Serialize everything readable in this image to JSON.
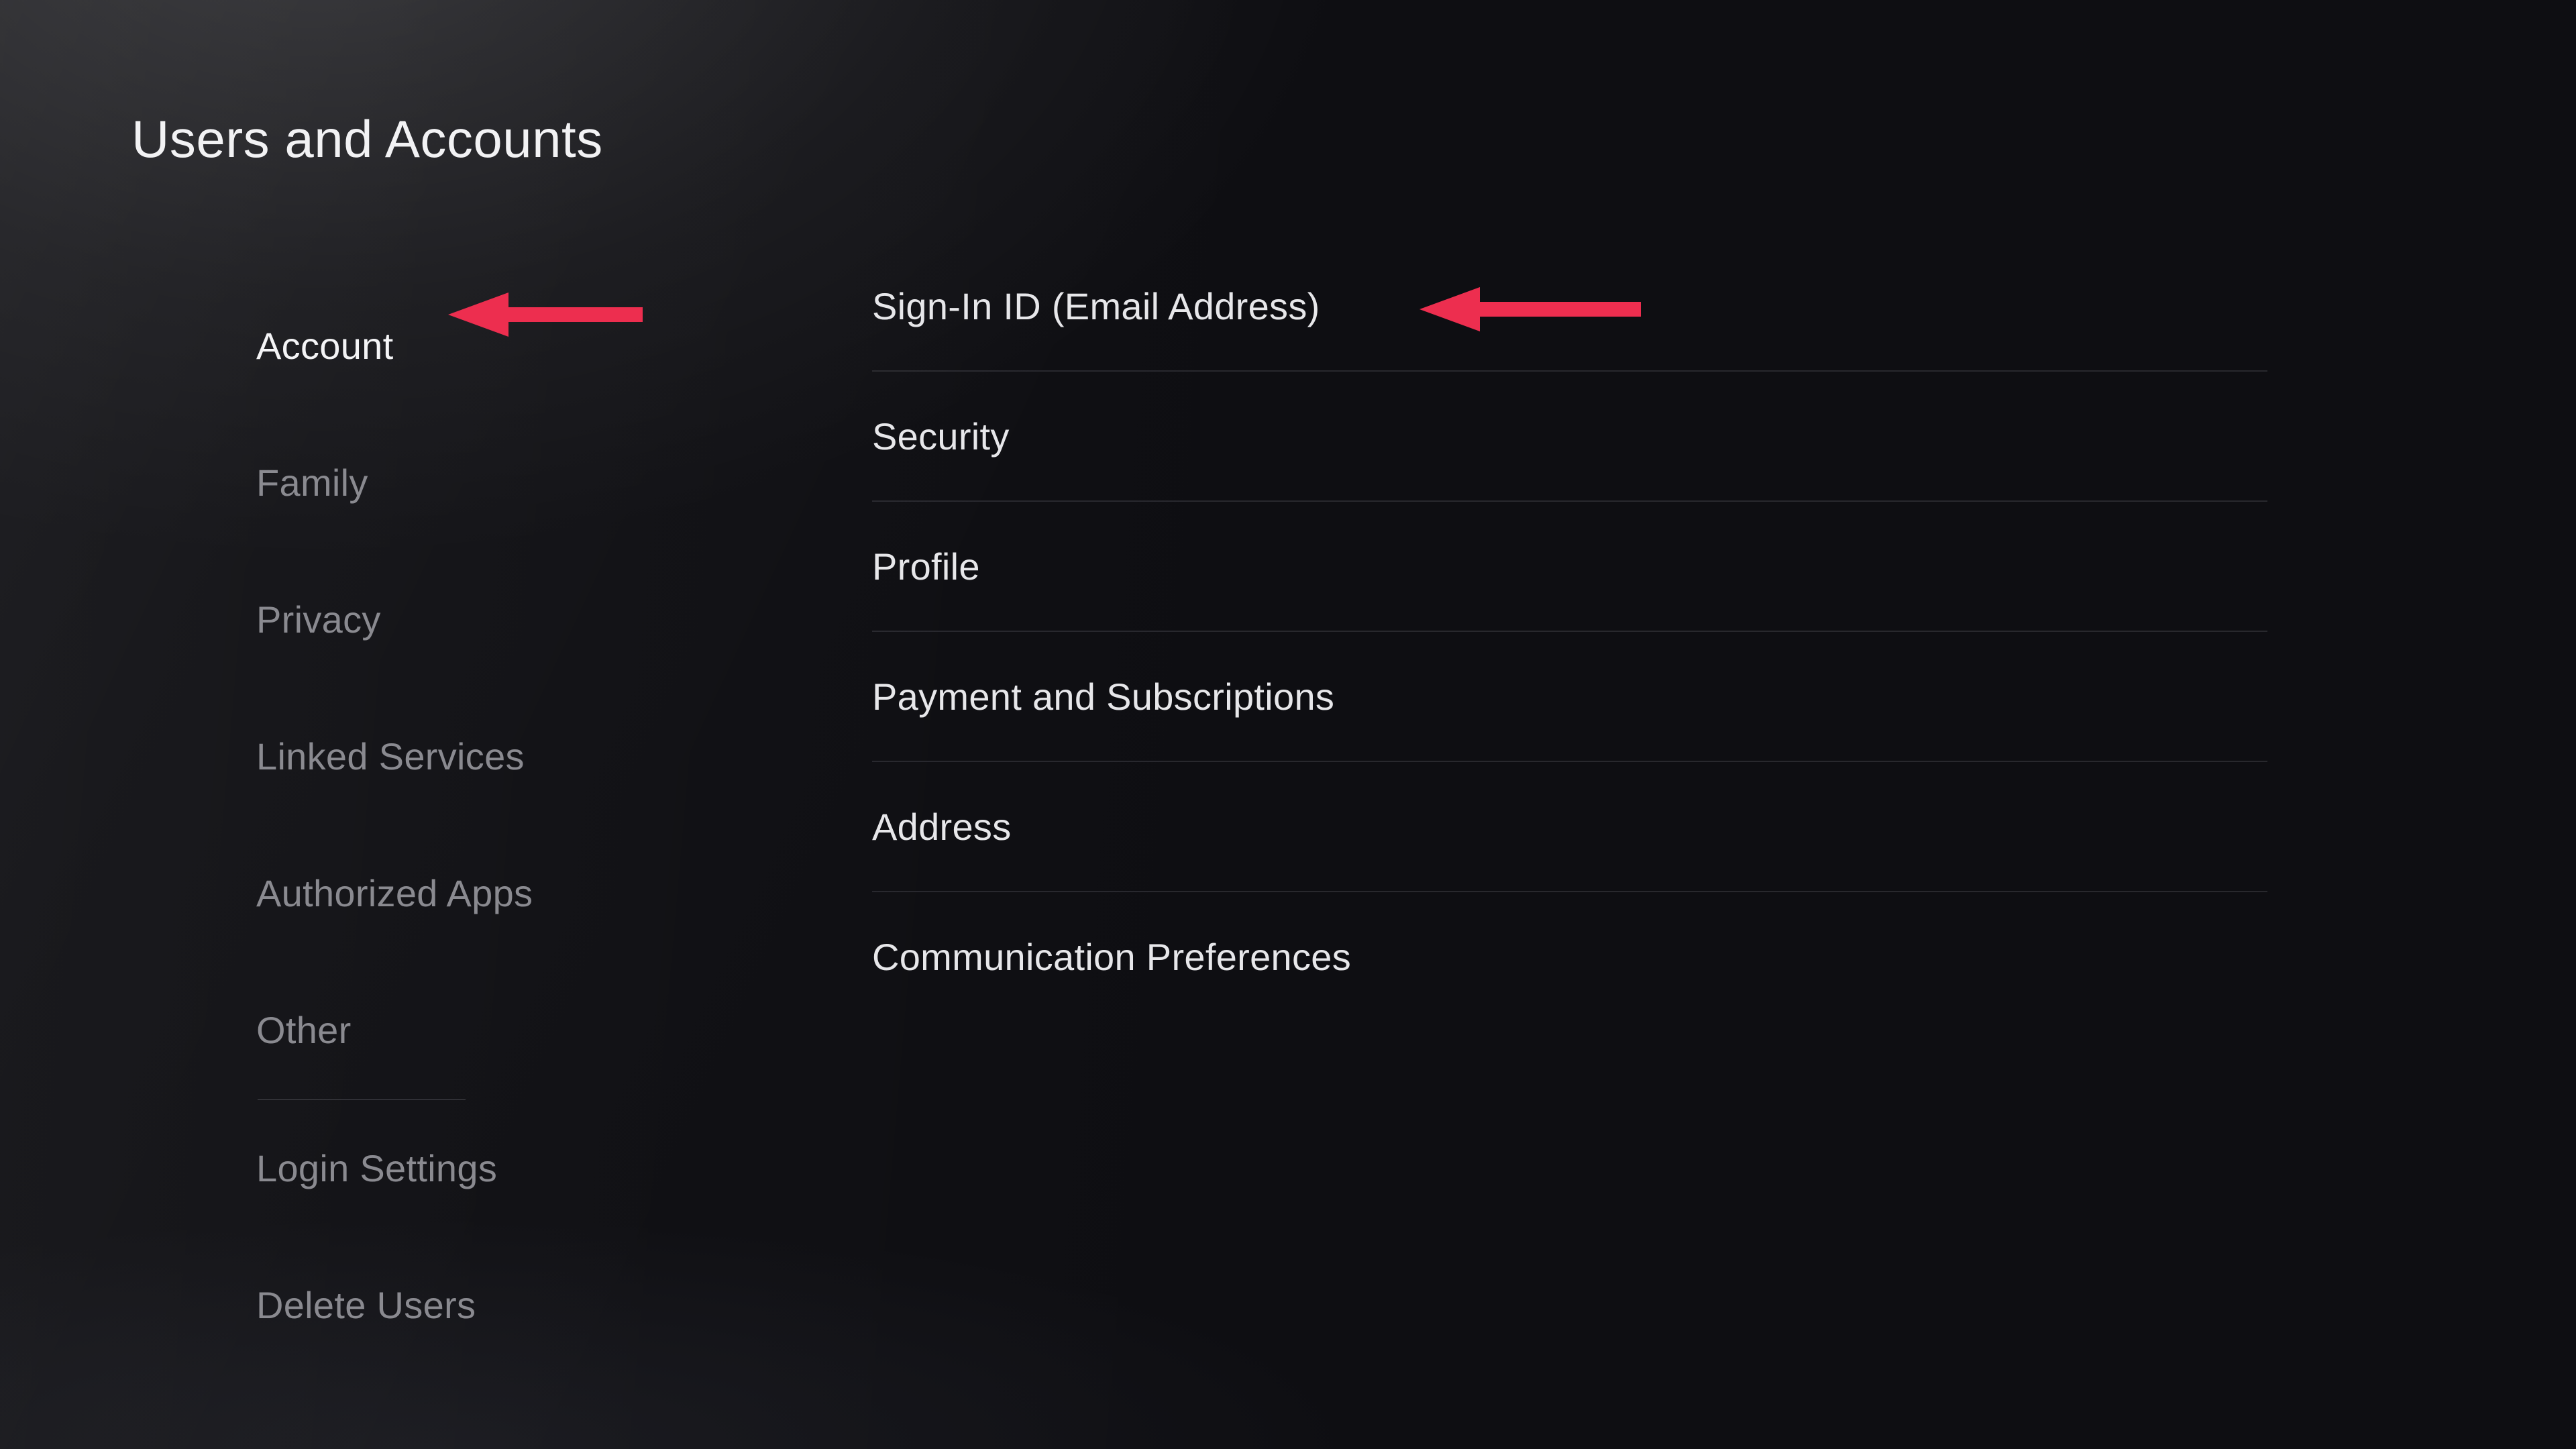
{
  "page_title": "Users and Accounts",
  "sidebar": {
    "items": [
      {
        "label": "Account",
        "active": true
      },
      {
        "label": "Family",
        "active": false
      },
      {
        "label": "Privacy",
        "active": false
      },
      {
        "label": "Linked Services",
        "active": false
      },
      {
        "label": "Authorized Apps",
        "active": false
      },
      {
        "label": "Other",
        "active": false
      }
    ],
    "footer_items": [
      {
        "label": "Login Settings"
      },
      {
        "label": "Delete Users"
      }
    ]
  },
  "main": {
    "items": [
      {
        "label": "Sign-In ID (Email Address)"
      },
      {
        "label": "Security"
      },
      {
        "label": "Profile"
      },
      {
        "label": "Payment and Subscriptions"
      },
      {
        "label": "Address"
      },
      {
        "label": "Communication Preferences"
      }
    ]
  },
  "annotations": {
    "arrow_color": "#ed2e4f",
    "arrows": [
      {
        "target": "sidebar-item-account"
      },
      {
        "target": "main-item-sign-in-id"
      }
    ]
  }
}
